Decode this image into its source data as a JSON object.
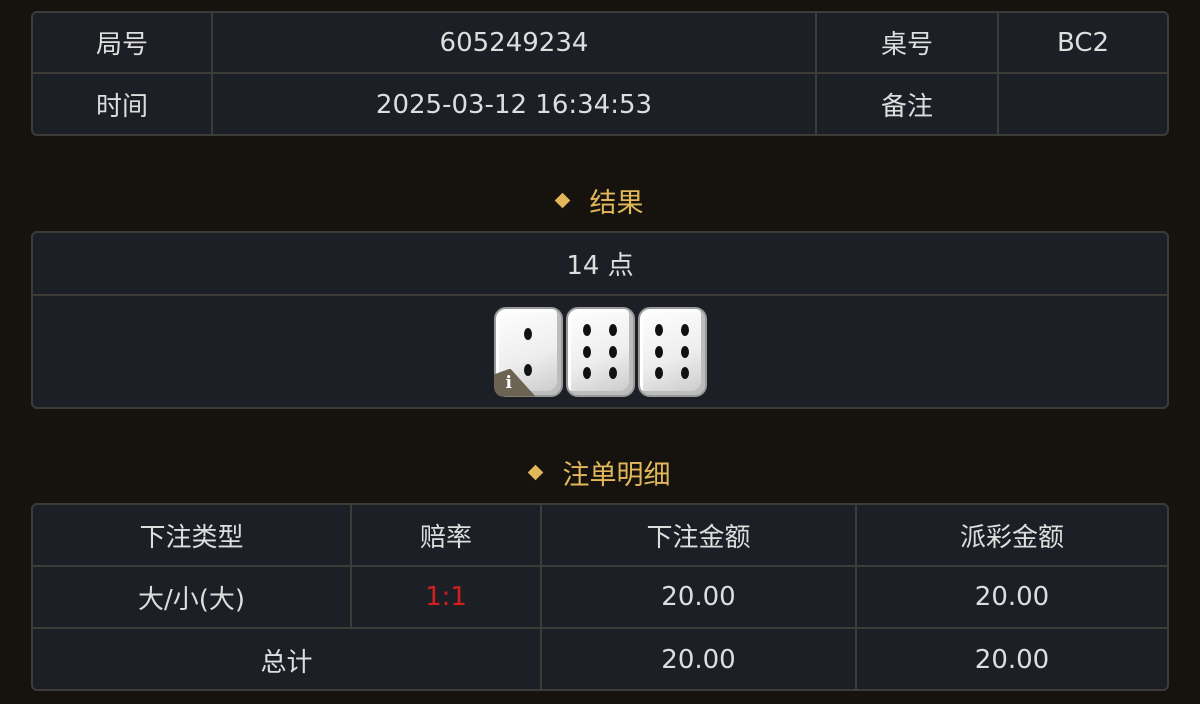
{
  "info": {
    "round_label": "局号",
    "round_value": "605249234",
    "table_label": "桌号",
    "table_value": "BC2",
    "time_label": "时间",
    "time_value": "2025-03-12 16:34:53",
    "note_label": "备注",
    "note_value": ""
  },
  "result": {
    "title": "结果",
    "points": "14 点",
    "dice_values": [
      2,
      6,
      6
    ],
    "info_badge": "i"
  },
  "bets": {
    "title": "注单明细",
    "headers": [
      "下注类型",
      "赔率",
      "下注金额",
      "派彩金额"
    ],
    "rows": [
      {
        "type": "大/小(大)",
        "odds": "1:1",
        "amount": "20.00",
        "payout": "20.00"
      }
    ],
    "total": {
      "label": "总计",
      "amount": "20.00",
      "payout": "20.00"
    },
    "odds_color": "#d41e1e"
  },
  "colors": {
    "accent": "#e2b75a",
    "background": "#16130f",
    "panel": "#1d1f26",
    "border": "#3e3c38"
  }
}
